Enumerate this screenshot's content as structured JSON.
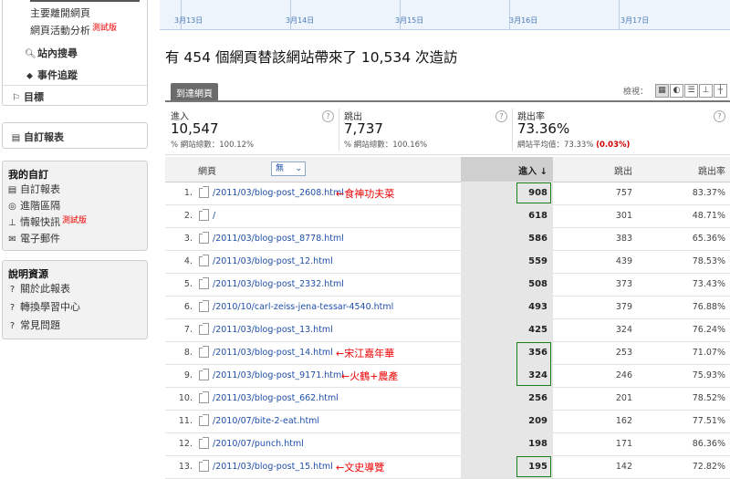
{
  "sidebar": {
    "top_items": [
      {
        "label": "主要離開網頁",
        "badge": ""
      },
      {
        "label": "網頁活動分析",
        "badge": "測試版"
      },
      {
        "label": "站內搜尋",
        "badge": ""
      },
      {
        "label": "事件追蹤",
        "badge": ""
      }
    ],
    "goals_label": "目標",
    "custom_reports_label": "自訂報表",
    "my_custom": {
      "heading": "我的自訂",
      "items": [
        {
          "label": "自訂報表",
          "badge": ""
        },
        {
          "label": "進階區隔",
          "badge": ""
        },
        {
          "label": "情報快訊",
          "badge": "測試版"
        },
        {
          "label": "電子郵件",
          "badge": ""
        }
      ]
    },
    "help": {
      "heading": "說明資源",
      "items": [
        {
          "label": "關於此報表"
        },
        {
          "label": "轉換學習中心"
        },
        {
          "label": "常見問題"
        }
      ]
    }
  },
  "timeline": {
    "dates": [
      "3月13日",
      "3月14日",
      "3月15日",
      "3月16日",
      "3月17日"
    ]
  },
  "headline": "有 454 個網頁替該網站帶來了 10,534 次造訪",
  "tab_label": "到達網頁",
  "view_label": "檢視：",
  "stats": [
    {
      "label": "進入",
      "value": "10,547",
      "sub": "% 網站總數：100.12%"
    },
    {
      "label": "跳出",
      "value": "7,737",
      "sub": "% 網站總數：100.16%"
    },
    {
      "label": "跳出率",
      "value": "73.36%",
      "sub": "網站平均值：73.33%",
      "sub_delta": "(0.03%)"
    }
  ],
  "table": {
    "columns": {
      "page": "網頁",
      "filter": "無",
      "entrances": "進入 ↓",
      "bounces": "跳出",
      "bounce_rate": "跳出率"
    },
    "rows": [
      {
        "n": "1.",
        "page": "/2011/03/blog-post_2608.html",
        "entrances": "908",
        "bounces": "757",
        "rate": "83.37%",
        "note": "←食神功夫菜"
      },
      {
        "n": "2.",
        "page": "/",
        "entrances": "618",
        "bounces": "301",
        "rate": "48.71%",
        "note": ""
      },
      {
        "n": "3.",
        "page": "/2011/03/blog-post_8778.html",
        "entrances": "586",
        "bounces": "383",
        "rate": "65.36%",
        "note": ""
      },
      {
        "n": "4.",
        "page": "/2011/03/blog-post_12.html",
        "entrances": "559",
        "bounces": "439",
        "rate": "78.53%",
        "note": ""
      },
      {
        "n": "5.",
        "page": "/2011/03/blog-post_2332.html",
        "entrances": "508",
        "bounces": "373",
        "rate": "73.43%",
        "note": ""
      },
      {
        "n": "6.",
        "page": "/2010/10/carl-zeiss-jena-tessar-4540.html",
        "entrances": "493",
        "bounces": "379",
        "rate": "76.88%",
        "note": ""
      },
      {
        "n": "7.",
        "page": "/2011/03/blog-post_13.html",
        "entrances": "425",
        "bounces": "324",
        "rate": "76.24%",
        "note": ""
      },
      {
        "n": "8.",
        "page": "/2011/03/blog-post_14.html",
        "entrances": "356",
        "bounces": "253",
        "rate": "71.07%",
        "note": "←宋江嘉年華"
      },
      {
        "n": "9.",
        "page": "/2011/03/blog-post_9171.html",
        "entrances": "324",
        "bounces": "246",
        "rate": "75.93%",
        "note": "←火鶴+農產"
      },
      {
        "n": "10.",
        "page": "/2011/03/blog-post_662.html",
        "entrances": "256",
        "bounces": "201",
        "rate": "78.52%",
        "note": ""
      },
      {
        "n": "11.",
        "page": "/2010/07/bite-2-eat.html",
        "entrances": "209",
        "bounces": "162",
        "rate": "77.51%",
        "note": ""
      },
      {
        "n": "12.",
        "page": "/2010/07/punch.html",
        "entrances": "198",
        "bounces": "171",
        "rate": "86.36%",
        "note": ""
      },
      {
        "n": "13.",
        "page": "/2011/03/blog-post_15.html",
        "entrances": "195",
        "bounces": "142",
        "rate": "72.82%",
        "note": "←文史導覽"
      }
    ]
  },
  "colors": {
    "annotation": "#e00000",
    "highlight_box": "#1a7f1a",
    "link": "#1f4fa8"
  },
  "icons": [
    "search-icon",
    "event-icon",
    "flag-icon",
    "report-icon",
    "segment-icon",
    "alert-icon",
    "email-icon",
    "help-icon",
    "page-link-icon",
    "sort-down-icon",
    "table-view-icon",
    "pie-view-icon",
    "bar-view-icon",
    "compare-view-icon",
    "pivot-view-icon"
  ]
}
